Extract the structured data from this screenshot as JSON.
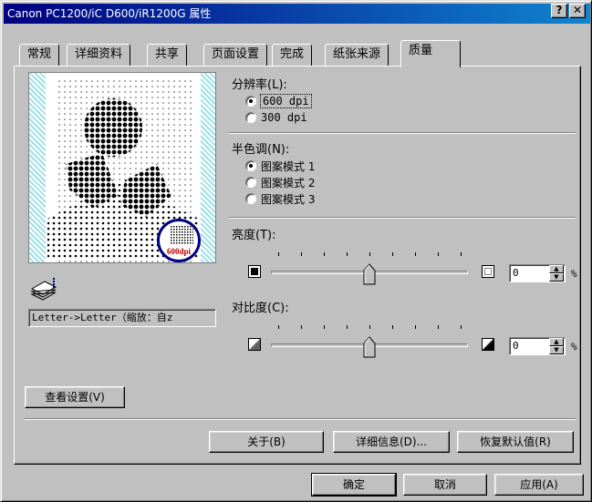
{
  "window": {
    "title": "Canon PC1200/iC D600/iR1200G 属性",
    "help_label": "?",
    "close_label": "✕"
  },
  "tabs": [
    "常规",
    "详细资料",
    "共享",
    "页面设置",
    "完成",
    "纸张来源",
    "质量"
  ],
  "preview": {
    "badge": "600dpi",
    "caption": "Letter->Letter（缩放：自z"
  },
  "resolution": {
    "title": "分辨率(L):",
    "options": [
      "600 dpi",
      "300 dpi"
    ],
    "selected": "600 dpi"
  },
  "halftone": {
    "title": "半色调(N):",
    "options": [
      "图案模式 1",
      "图案模式 2",
      "图案模式 3"
    ],
    "selected": "图案模式 1"
  },
  "brightness": {
    "title": "亮度(T):",
    "value": "0",
    "unit": "%",
    "level": 0.5
  },
  "contrast": {
    "title": "对比度(C):",
    "value": "0",
    "unit": "%",
    "level": 0.5
  },
  "buttons": {
    "view_settings": "查看设置(V)",
    "about": "关于(B)",
    "details": "详细信息(D)...",
    "restore_defaults": "恢复默认值(R)",
    "ok": "确定",
    "cancel": "取消",
    "apply": "应用(A)"
  },
  "colors": {
    "title_start": "#000080",
    "title_end": "#1084d0",
    "preview_hatch": "#9ee0e8",
    "badge_ring": "#000080",
    "badge_text": "#c00000"
  }
}
